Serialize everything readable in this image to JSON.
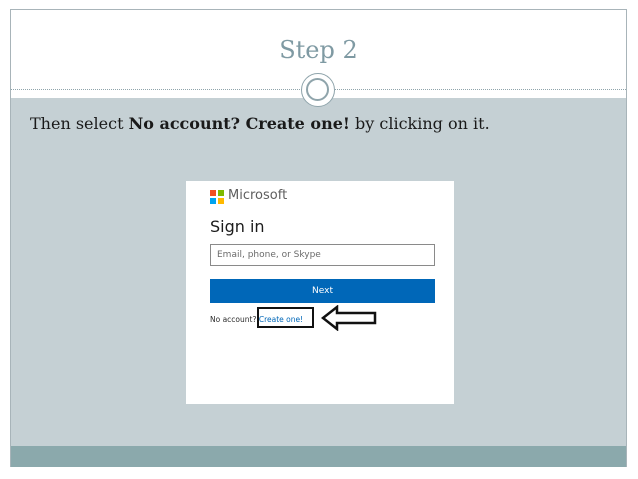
{
  "slide": {
    "title": "Step 2",
    "instruction": {
      "before": "Then select ",
      "bold": "No account? Create one!",
      "after": " by clicking on it."
    }
  },
  "signin": {
    "brand": "Microsoft",
    "heading": "Sign in",
    "email_placeholder": "Email, phone, or Skype",
    "next_label": "Next",
    "no_account_text": "No account? ",
    "create_link": "Create one!"
  },
  "colors": {
    "accent_blue": "#0067b8",
    "content_bg": "#c5d0d4",
    "footer_band": "#8ba9ac",
    "logo": [
      "#f25022",
      "#7fba00",
      "#00a4ef",
      "#ffb900"
    ]
  },
  "icons": [
    "microsoft-logo-icon",
    "left-arrow-icon"
  ]
}
